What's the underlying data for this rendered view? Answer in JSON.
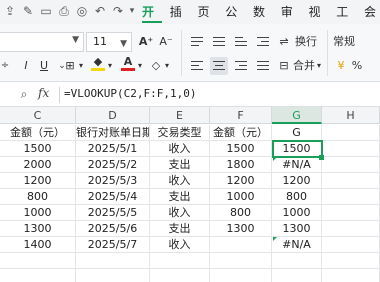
{
  "ribbon": {
    "tabs": [
      "开始",
      "插入",
      "页面",
      "公式",
      "数据",
      "审阅",
      "视图",
      "工具"
    ],
    "tab_overflow": "会",
    "active_tab": "开始",
    "font_size": "11",
    "wrap_text_label": "换行",
    "merge_label": "合并",
    "number_format": "常规",
    "accent_color": "#18a058"
  },
  "formula_bar": {
    "fx_label": "fx",
    "formula": "=VLOOKUP(C2,F:F,1,0)"
  },
  "sheet": {
    "columns": [
      "C",
      "D",
      "E",
      "F",
      "G",
      "H"
    ],
    "selected_column": "G",
    "rows": [
      [
        "金额（元）",
        "银行对账单日期",
        "交易类型",
        "金额（元）",
        "G",
        ""
      ],
      [
        "1500",
        "2025/5/1",
        "收入",
        "1500",
        "1500",
        ""
      ],
      [
        "2000",
        "2025/5/2",
        "支出",
        "1800",
        "#N/A",
        ""
      ],
      [
        "1200",
        "2025/5/3",
        "收入",
        "1200",
        "1200",
        ""
      ],
      [
        "800",
        "2025/5/4",
        "支出",
        "1000",
        "800",
        ""
      ],
      [
        "1000",
        "2025/5/5",
        "收入",
        "800",
        "1000",
        ""
      ],
      [
        "1300",
        "2025/5/6",
        "支出",
        "1300",
        "1300",
        ""
      ],
      [
        "1400",
        "2025/5/7",
        "收入",
        "",
        "#N/A",
        ""
      ]
    ]
  }
}
